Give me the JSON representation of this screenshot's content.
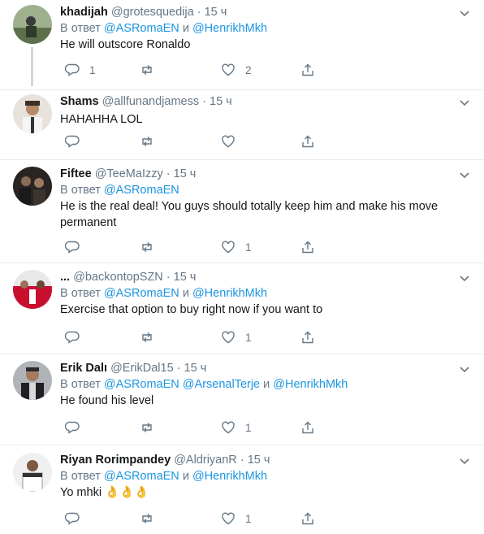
{
  "reply_prefix": "В ответ",
  "and_word": "и",
  "tweets": [
    {
      "name": "khadijah",
      "handle": "@grotesquedija",
      "time": "15 ч",
      "mentions": [
        "@ASRomaEN",
        "@HenrikhMkh"
      ],
      "text": "He will outscore Ronaldo",
      "replies": "1",
      "retweets": "",
      "likes": "2"
    },
    {
      "name": "Shams",
      "handle": "@allfunandjamess",
      "time": "15 ч",
      "mentions": [],
      "text": "HAHAHHA LOL",
      "replies": "",
      "retweets": "",
      "likes": ""
    },
    {
      "name": "Fiftee",
      "handle": "@TeeMaIzzy",
      "time": "15 ч",
      "mentions": [
        "@ASRomaEN"
      ],
      "text": "He is the real deal! You guys should totally keep him and make his move permanent",
      "replies": "",
      "retweets": "",
      "likes": "1"
    },
    {
      "name": "...",
      "handle": "@backontopSZN",
      "time": "15 ч",
      "mentions": [
        "@ASRomaEN",
        "@HenrikhMkh"
      ],
      "text": "Exercise that option to buy right now if you want to",
      "replies": "",
      "retweets": "",
      "likes": "1"
    },
    {
      "name": "Erik Dalı",
      "handle": "@ErikDal15",
      "time": "15 ч",
      "mentions": [
        "@ASRomaEN",
        "@ArsenalTerje",
        "@HenrikhMkh"
      ],
      "text": "He found his level",
      "replies": "",
      "retweets": "",
      "likes": "1"
    },
    {
      "name": "Riyan Rorimpandey",
      "handle": "@AldriyanR",
      "time": "15 ч",
      "mentions": [
        "@ASRomaEN",
        "@HenrikhMkh"
      ],
      "text": "Yo mhki 👌👌👌",
      "replies": "",
      "retweets": "",
      "likes": "1"
    }
  ],
  "icons": {
    "reply": "reply-icon",
    "retweet": "retweet-icon",
    "like": "heart-icon",
    "share": "share-icon",
    "more": "chevron-down-icon"
  },
  "colors": {
    "link": "#1b95e0",
    "muted": "#657786",
    "text": "#14171a",
    "divider": "#e6ecf0"
  }
}
